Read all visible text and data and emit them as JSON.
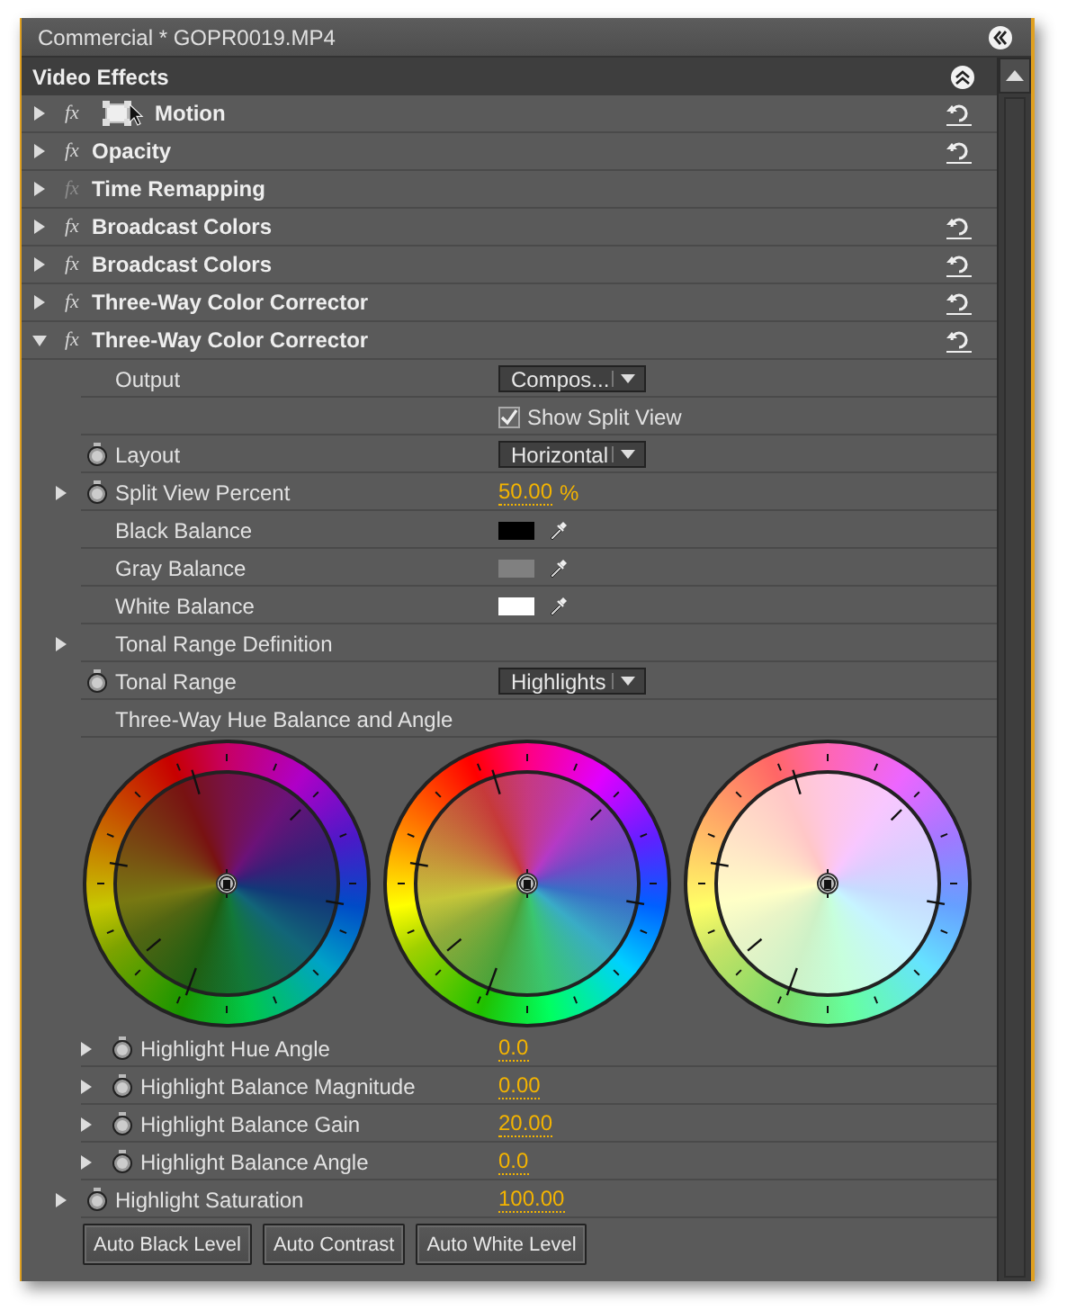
{
  "window": {
    "title": "Commercial * GOPR0019.MP4"
  },
  "section_title": "Video Effects",
  "effects": [
    {
      "name": "Motion",
      "kind": "motion",
      "fx_badge": "fx",
      "fx_enabled": true,
      "expanded": false,
      "resettable": true
    },
    {
      "name": "Opacity",
      "kind": "standard",
      "fx_badge": "fx",
      "fx_enabled": true,
      "expanded": false,
      "resettable": true
    },
    {
      "name": "Time Remapping",
      "kind": "standard",
      "fx_badge": "fx",
      "fx_enabled": false,
      "expanded": false,
      "resettable": false
    },
    {
      "name": "Broadcast Colors",
      "kind": "standard",
      "fx_badge": "fx",
      "fx_enabled": true,
      "expanded": false,
      "resettable": true
    },
    {
      "name": "Broadcast Colors",
      "kind": "standard",
      "fx_badge": "fx",
      "fx_enabled": true,
      "expanded": false,
      "resettable": true
    },
    {
      "name": "Three-Way Color Corrector",
      "kind": "standard",
      "fx_badge": "fx",
      "fx_enabled": true,
      "expanded": false,
      "resettable": true
    },
    {
      "name": "Three-Way Color Corrector",
      "kind": "standard",
      "fx_badge": "fx",
      "fx_enabled": true,
      "expanded": true,
      "resettable": true,
      "properties": [
        {
          "kind": "dropdown",
          "label": "Output",
          "stopwatch": false,
          "value": "Compos..."
        },
        {
          "kind": "checkbox",
          "label": "Show Split View",
          "checked": true
        },
        {
          "kind": "dropdown",
          "label": "Layout",
          "stopwatch": true,
          "value": "Horizontal"
        },
        {
          "kind": "value",
          "label": "Split View Percent",
          "stopwatch": true,
          "expanded": false,
          "value": "50.00",
          "unit": "%"
        },
        {
          "kind": "color",
          "label": "Black Balance",
          "color": "#000000"
        },
        {
          "kind": "color",
          "label": "Gray Balance",
          "color": "#808080"
        },
        {
          "kind": "color",
          "label": "White Balance",
          "color": "#ffffff"
        },
        {
          "kind": "group",
          "label": "Tonal Range Definition",
          "expanded": false
        },
        {
          "kind": "dropdown",
          "label": "Tonal Range",
          "stopwatch": true,
          "value": "Highlights"
        },
        {
          "kind": "wheels",
          "label": "Three-Way Hue Balance and Angle",
          "children": [
            {
              "kind": "value",
              "label": "Highlight Hue Angle",
              "stopwatch": true,
              "expanded": false,
              "value": "0.0"
            },
            {
              "kind": "value",
              "label": "Highlight Balance Magnitude",
              "stopwatch": true,
              "expanded": false,
              "value": "0.00"
            },
            {
              "kind": "value",
              "label": "Highlight Balance Gain",
              "stopwatch": true,
              "expanded": false,
              "value": "20.00"
            },
            {
              "kind": "value",
              "label": "Highlight Balance Angle",
              "stopwatch": true,
              "expanded": false,
              "value": "0.0"
            }
          ]
        },
        {
          "kind": "value",
          "label": "Highlight Saturation",
          "stopwatch": true,
          "expanded": false,
          "value": "100.00"
        }
      ],
      "buttons": [
        "Auto Black Level",
        "Auto Contrast",
        "Auto White Level"
      ]
    }
  ]
}
